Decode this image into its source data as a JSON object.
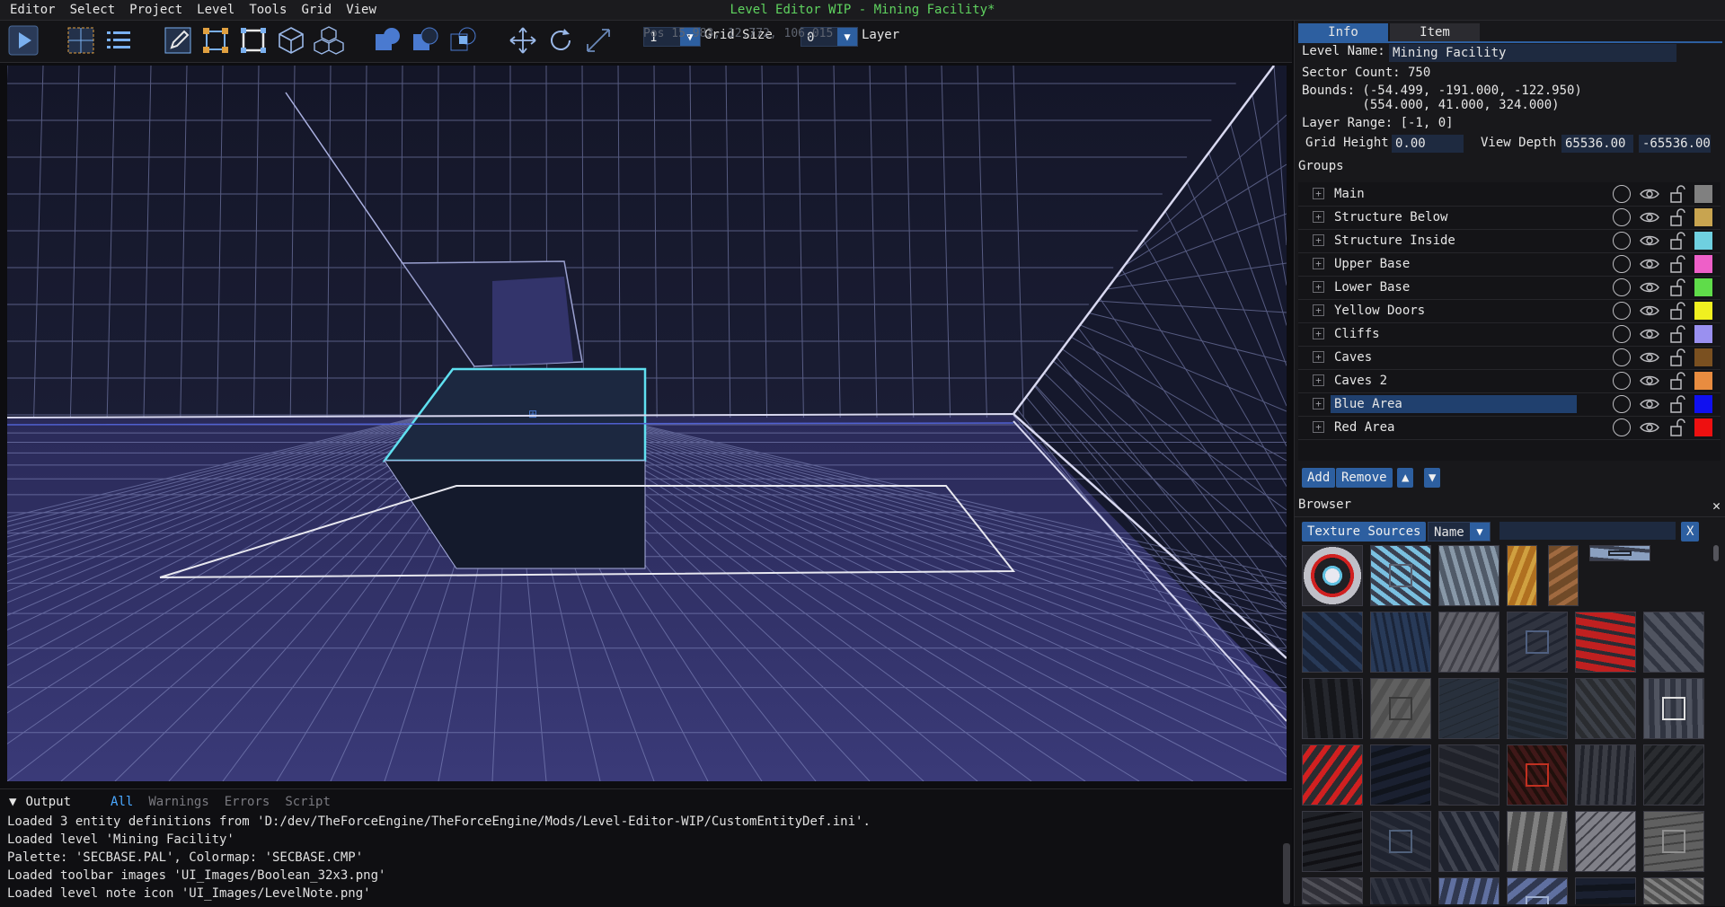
{
  "window": {
    "title": "Level Editor WIP - Mining Facility*"
  },
  "menu": [
    "Editor",
    "Select",
    "Project",
    "Level",
    "Tools",
    "Grid",
    "View"
  ],
  "toolbar": {
    "buttons": [
      {
        "name": "play-button",
        "icon": "play-icon"
      },
      {
        "name": "select-grid-button",
        "icon": "grid-select-icon"
      },
      {
        "name": "list-button",
        "icon": "list-icon"
      },
      {
        "name": "draw-button",
        "icon": "pencil-icon"
      },
      {
        "name": "vertex-mode-button",
        "icon": "vertex-icon"
      },
      {
        "name": "edge-mode-button",
        "icon": "edge-icon"
      },
      {
        "name": "sector-mode-button",
        "icon": "cube-icon"
      },
      {
        "name": "entity-mode-button",
        "icon": "cubes-icon"
      },
      {
        "name": "boolean-union-button",
        "icon": "union-icon"
      },
      {
        "name": "boolean-subtract-button",
        "icon": "subtract-icon"
      },
      {
        "name": "boolean-intersect-button",
        "icon": "intersect-icon"
      },
      {
        "name": "move-button",
        "icon": "move-icon"
      },
      {
        "name": "rotate-button",
        "icon": "rotate-icon"
      },
      {
        "name": "scale-button",
        "icon": "scale-icon"
      }
    ],
    "grid_size_value": "1",
    "grid_size_label": "Grid Size",
    "layer_value": "0",
    "layer_label": "Layer",
    "pos_readout": "Pos 15.983, 12.772, 106.015"
  },
  "info_panel": {
    "tabs": [
      "Info",
      "Item"
    ],
    "active_tab": "Info",
    "level_name_label": "Level Name:",
    "level_name_value": "Mining Facility",
    "sector_count": "Sector Count: 750",
    "bounds_line1": "Bounds: (-54.499, -191.000, -122.950)",
    "bounds_line2": "        (554.000, 41.000, 324.000)",
    "layer_range": "Layer Range: [-1, 0]",
    "grid_height_label": "Grid Height",
    "grid_height_value": "0.00",
    "view_depth_label": "View Depth",
    "view_depth_min": "65536.00",
    "view_depth_max": "-65536.00"
  },
  "groups": {
    "header": "Groups",
    "items": [
      {
        "name": "Main",
        "color": "#808080",
        "selected": false
      },
      {
        "name": "Structure Below",
        "color": "#c8a450",
        "selected": false
      },
      {
        "name": "Structure Inside",
        "color": "#6fd0e0",
        "selected": false
      },
      {
        "name": "Upper Base",
        "color": "#ee5fc8",
        "selected": false
      },
      {
        "name": "Lower Base",
        "color": "#5fdc4a",
        "selected": false
      },
      {
        "name": "Yellow Doors",
        "color": "#f0f020",
        "selected": false
      },
      {
        "name": "Cliffs",
        "color": "#9a90f0",
        "selected": false
      },
      {
        "name": "Caves",
        "color": "#7a5020",
        "selected": false
      },
      {
        "name": "Caves 2",
        "color": "#e88c40",
        "selected": false
      },
      {
        "name": "Blue Area",
        "color": "#1010f0",
        "selected": true
      },
      {
        "name": "Red Area",
        "color": "#ee1010",
        "selected": false
      }
    ],
    "add_label": "Add",
    "remove_label": "Remove"
  },
  "browser": {
    "header": "Browser",
    "source_label": "Texture Sources",
    "sort_value": "Name",
    "clear_label": "X",
    "close_label": "✕"
  },
  "output": {
    "title": "Output",
    "tabs": [
      "All",
      "Warnings",
      "Errors",
      "Script"
    ],
    "active_tab": "All",
    "lines": [
      "Loaded 3 entity definitions from 'D:/dev/TheForceEngine/TheForceEngine/Mods/Level-Editor-WIP/CustomEntityDef.ini'.",
      "Loaded level 'Mining Facility'",
      "Palette: 'SECBASE.PAL', Colormap: 'SECBASE.CMP'",
      "Loaded toolbar images 'UI_Images/Boolean_32x3.png'",
      "Loaded level note icon 'UI_Images/LevelNote.png'"
    ]
  },
  "colors": {
    "accent": "#2d5fa0",
    "title_green": "#5fd35f",
    "grid_line": "#8c93c8",
    "selection": "#5fe0f0"
  }
}
